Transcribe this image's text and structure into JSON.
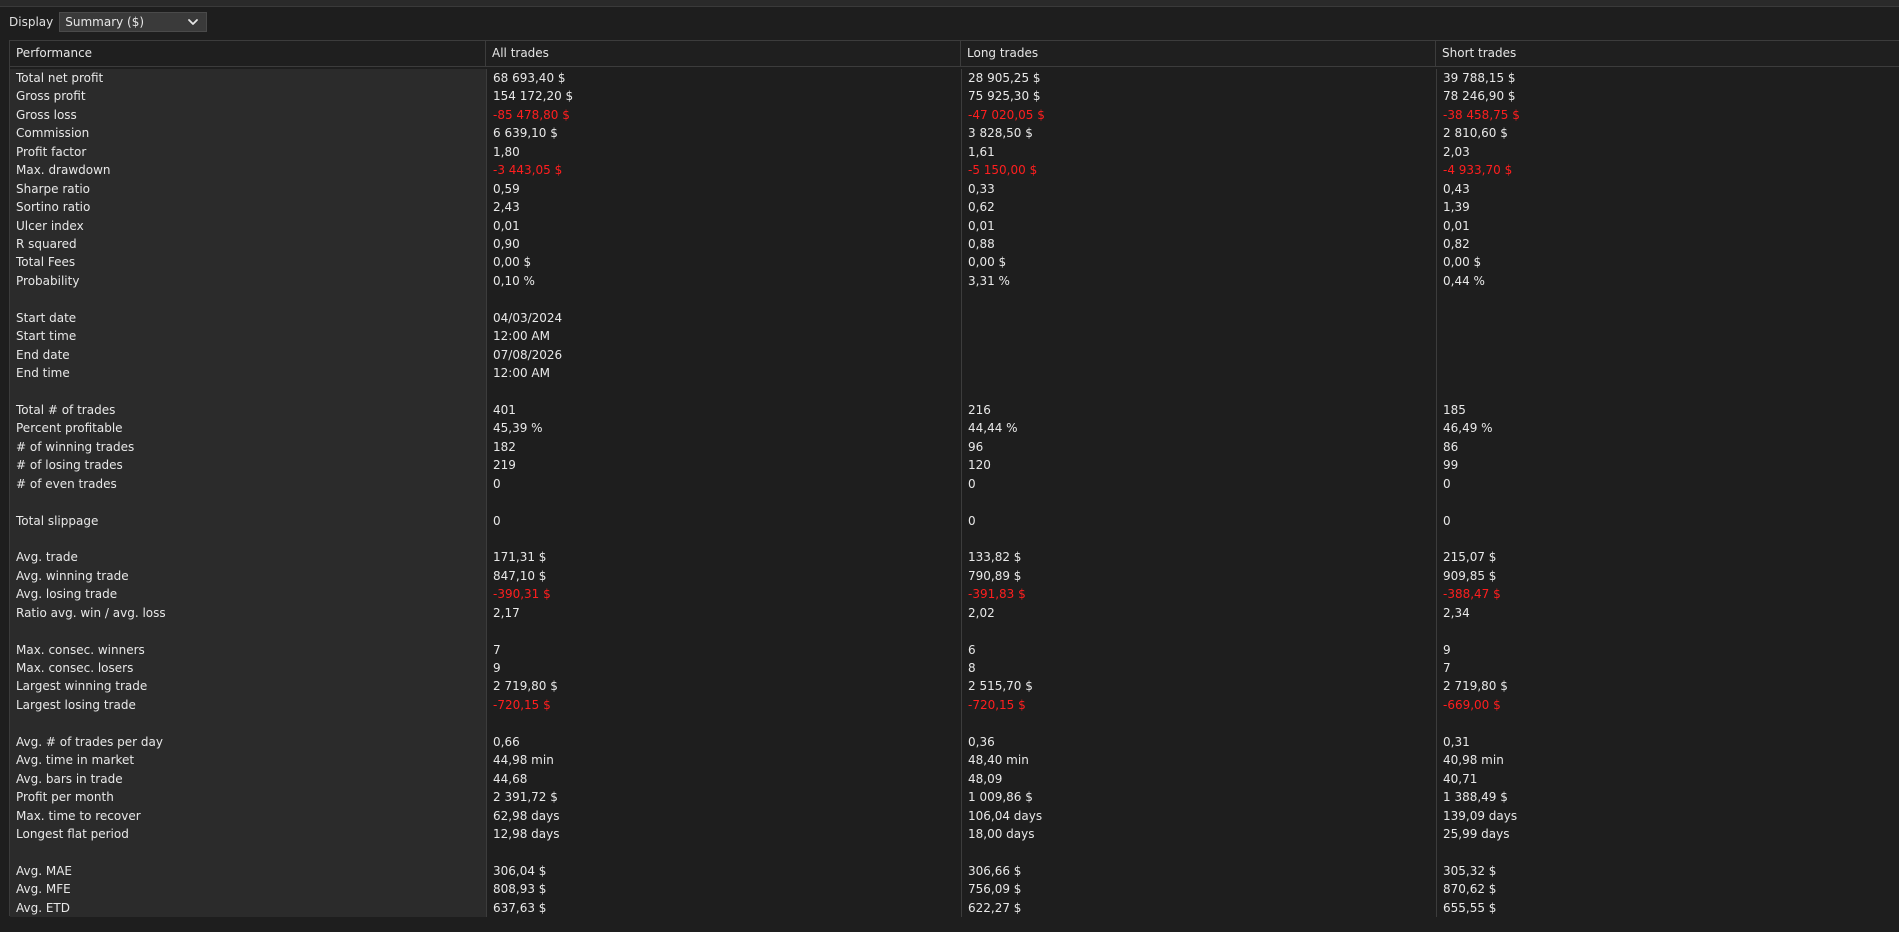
{
  "toolbar": {
    "display_label": "Display",
    "display_value": "Summary ($)"
  },
  "headers": [
    "Performance",
    "All trades",
    "Long trades",
    "Short trades"
  ],
  "rows": [
    {
      "label": "Total net profit",
      "all": "68 693,40 $",
      "long": "28 905,25 $",
      "short": "39 788,15 $"
    },
    {
      "label": "Gross profit",
      "all": "154 172,20 $",
      "long": "75 925,30 $",
      "short": "78 246,90 $"
    },
    {
      "label": "Gross loss",
      "all": "-85 478,80 $",
      "long": "-47 020,05 $",
      "short": "-38 458,75 $",
      "negative": true
    },
    {
      "label": "Commission",
      "all": "6 639,10 $",
      "long": "3 828,50 $",
      "short": "2 810,60 $"
    },
    {
      "label": "Profit factor",
      "all": "1,80",
      "long": "1,61",
      "short": "2,03"
    },
    {
      "label": "Max. drawdown",
      "all": "-3 443,05 $",
      "long": "-5 150,00 $",
      "short": "-4 933,70 $",
      "negative": true
    },
    {
      "label": "Sharpe ratio",
      "all": "0,59",
      "long": "0,33",
      "short": "0,43"
    },
    {
      "label": "Sortino ratio",
      "all": "2,43",
      "long": "0,62",
      "short": "1,39"
    },
    {
      "label": "Ulcer index",
      "all": "0,01",
      "long": "0,01",
      "short": "0,01"
    },
    {
      "label": "R squared",
      "all": "0,90",
      "long": "0,88",
      "short": "0,82"
    },
    {
      "label": "Total Fees",
      "all": "0,00 $",
      "long": "0,00 $",
      "short": "0,00 $"
    },
    {
      "label": "Probability",
      "all": "0,10 %",
      "long": "3,31 %",
      "short": "0,44 %"
    },
    {
      "label": "",
      "all": "",
      "long": "",
      "short": ""
    },
    {
      "label": "Start date",
      "all": "04/03/2024",
      "long": "",
      "short": ""
    },
    {
      "label": "Start time",
      "all": "12:00 AM",
      "long": "",
      "short": ""
    },
    {
      "label": "End date",
      "all": "07/08/2026",
      "long": "",
      "short": ""
    },
    {
      "label": "End time",
      "all": "12:00 AM",
      "long": "",
      "short": ""
    },
    {
      "label": "",
      "all": "",
      "long": "",
      "short": ""
    },
    {
      "label": "Total # of trades",
      "all": "401",
      "long": "216",
      "short": "185"
    },
    {
      "label": "Percent profitable",
      "all": "45,39 %",
      "long": "44,44 %",
      "short": "46,49 %"
    },
    {
      "label": "# of winning trades",
      "all": "182",
      "long": "96",
      "short": "86"
    },
    {
      "label": "# of losing trades",
      "all": "219",
      "long": "120",
      "short": "99"
    },
    {
      "label": "# of even trades",
      "all": "0",
      "long": "0",
      "short": "0"
    },
    {
      "label": "",
      "all": "",
      "long": "",
      "short": ""
    },
    {
      "label": "Total slippage",
      "all": "0",
      "long": "0",
      "short": "0"
    },
    {
      "label": "",
      "all": "",
      "long": "",
      "short": ""
    },
    {
      "label": "Avg. trade",
      "all": "171,31 $",
      "long": "133,82 $",
      "short": "215,07 $"
    },
    {
      "label": "Avg. winning trade",
      "all": "847,10 $",
      "long": "790,89 $",
      "short": "909,85 $"
    },
    {
      "label": "Avg. losing trade",
      "all": "-390,31 $",
      "long": "-391,83 $",
      "short": "-388,47 $",
      "negative": true
    },
    {
      "label": "Ratio avg. win / avg. loss",
      "all": "2,17",
      "long": "2,02",
      "short": "2,34"
    },
    {
      "label": "",
      "all": "",
      "long": "",
      "short": ""
    },
    {
      "label": "Max. consec. winners",
      "all": "7",
      "long": "6",
      "short": "9"
    },
    {
      "label": "Max. consec. losers",
      "all": "9",
      "long": "8",
      "short": "7"
    },
    {
      "label": "Largest winning trade",
      "all": "2 719,80 $",
      "long": "2 515,70 $",
      "short": "2 719,80 $"
    },
    {
      "label": "Largest losing trade",
      "all": "-720,15 $",
      "long": "-720,15 $",
      "short": "-669,00 $",
      "negative": true
    },
    {
      "label": "",
      "all": "",
      "long": "",
      "short": ""
    },
    {
      "label": "Avg. # of trades per day",
      "all": "0,66",
      "long": "0,36",
      "short": "0,31"
    },
    {
      "label": "Avg. time in market",
      "all": "44,98 min",
      "long": "48,40 min",
      "short": "40,98 min"
    },
    {
      "label": "Avg. bars in trade",
      "all": "44,68",
      "long": "48,09",
      "short": "40,71"
    },
    {
      "label": "Profit per month",
      "all": "2 391,72 $",
      "long": "1 009,86 $",
      "short": "1 388,49 $"
    },
    {
      "label": "Max. time to recover",
      "all": "62,98 days",
      "long": "106,04 days",
      "short": "139,09 days"
    },
    {
      "label": "Longest flat period",
      "all": "12,98 days",
      "long": "18,00 days",
      "short": "25,99 days"
    },
    {
      "label": "",
      "all": "",
      "long": "",
      "short": ""
    },
    {
      "label": "Avg. MAE",
      "all": "306,04 $",
      "long": "306,66 $",
      "short": "305,32 $"
    },
    {
      "label": "Avg. MFE",
      "all": "808,93 $",
      "long": "756,09 $",
      "short": "870,62 $"
    },
    {
      "label": "Avg. ETD",
      "all": "637,63 $",
      "long": "622,27 $",
      "short": "655,55 $"
    }
  ],
  "colors": {
    "background": "#1e1e1e",
    "label_column": "#2b2b2b",
    "text": "#e8e8e8",
    "negative": "#ff1e1e",
    "grid_line": "#3c3c3c"
  },
  "icons": {
    "dropdown": "chevron-down-icon"
  }
}
